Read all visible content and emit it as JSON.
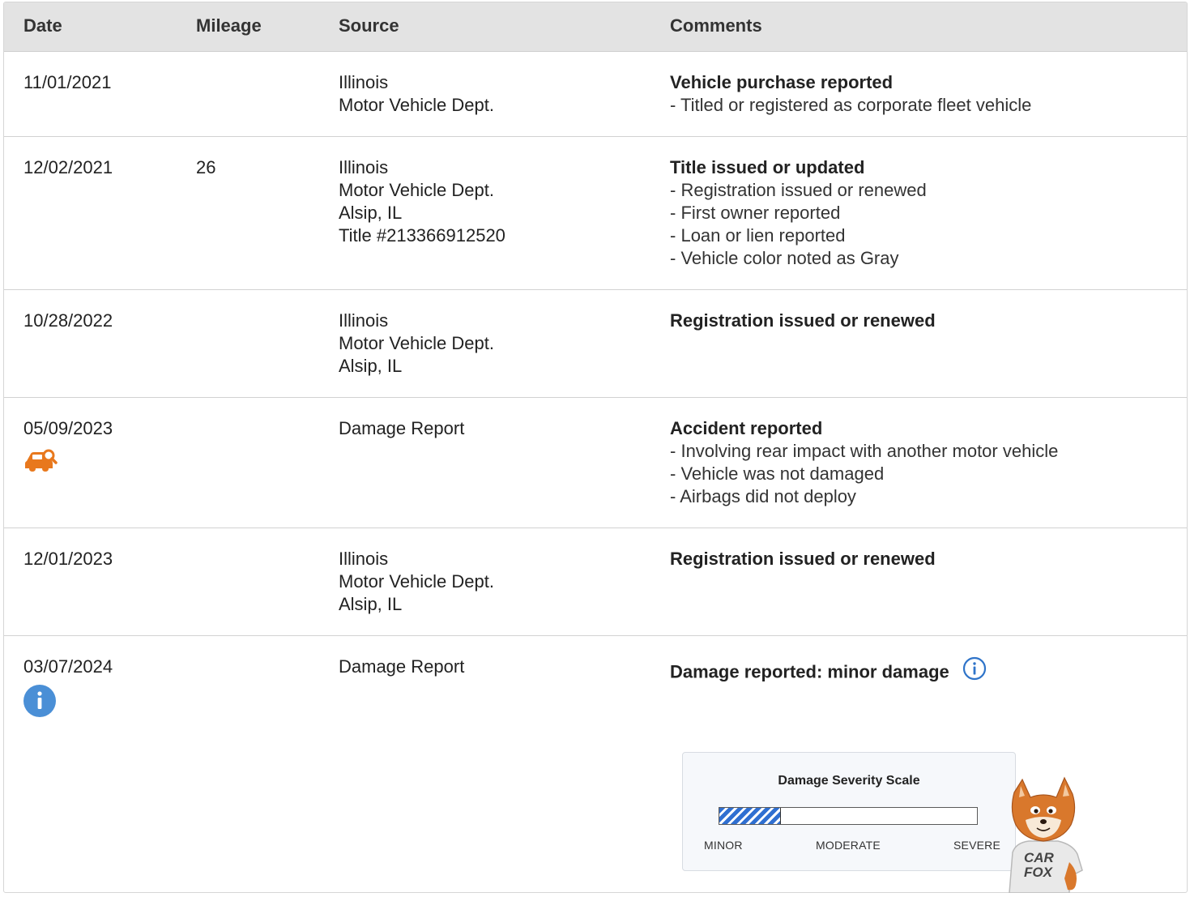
{
  "columns": {
    "date": "Date",
    "mileage": "Mileage",
    "source": "Source",
    "comments": "Comments"
  },
  "rows": [
    {
      "date": "11/01/2021",
      "mileage": "",
      "source": [
        "Illinois",
        "Motor Vehicle Dept."
      ],
      "comment_title": "Vehicle purchase reported",
      "comment_items": [
        "Titled or registered as corporate fleet vehicle"
      ]
    },
    {
      "date": "12/02/2021",
      "mileage": "26",
      "source": [
        "Illinois",
        "Motor Vehicle Dept.",
        "Alsip, IL",
        "Title #213366912520"
      ],
      "comment_title": "Title issued or updated",
      "comment_items": [
        "Registration issued or renewed",
        "First owner reported",
        "Loan or lien reported",
        "Vehicle color noted as Gray"
      ]
    },
    {
      "date": "10/28/2022",
      "mileage": "",
      "source": [
        "Illinois",
        "Motor Vehicle Dept.",
        "Alsip, IL"
      ],
      "comment_title": "Registration issued or renewed",
      "comment_items": []
    },
    {
      "date": "05/09/2023",
      "mileage": "",
      "icon": "car-search-icon",
      "icon_color": "#e8781d",
      "source": [
        "Damage Report"
      ],
      "comment_title": "Accident reported",
      "comment_items": [
        "Involving rear impact with another motor vehicle",
        "Vehicle was not damaged",
        "Airbags did not deploy"
      ]
    },
    {
      "date": "12/01/2023",
      "mileage": "",
      "source": [
        "Illinois",
        "Motor Vehicle Dept.",
        "Alsip, IL"
      ],
      "comment_title": "Registration issued or renewed",
      "comment_items": []
    },
    {
      "date": "03/07/2024",
      "mileage": "",
      "icon": "info-filled-icon",
      "icon_color": "#4a8fd6",
      "source": [
        "Damage Report"
      ],
      "comment_title": "Damage reported: minor damage",
      "comment_info_icon": "info-outline-icon",
      "comment_items": []
    }
  ],
  "severity_scale": {
    "title": "Damage Severity Scale",
    "level_fraction": 0.24,
    "labels": [
      "MINOR",
      "MODERATE",
      "SEVERE"
    ],
    "fill_color": "#2f6fd1"
  },
  "mascot": {
    "icon": "carfox-mascot",
    "shirt_text": [
      "CAR",
      "FOX"
    ]
  }
}
